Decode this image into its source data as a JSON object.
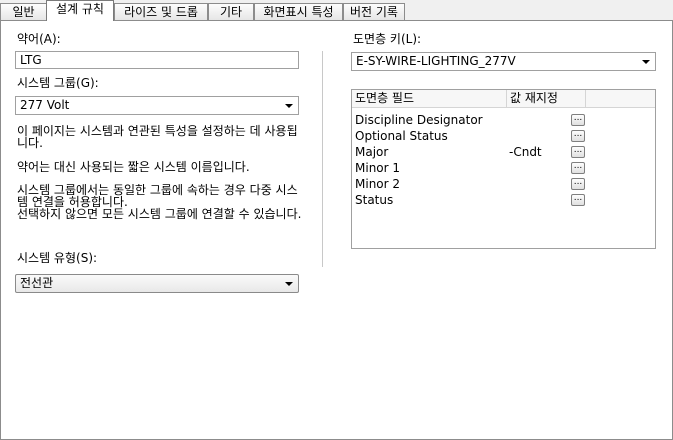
{
  "tabs": [
    {
      "label": "일반",
      "active": false
    },
    {
      "label": "설계 규칙",
      "active": true
    },
    {
      "label": "라이즈 및 드롭",
      "active": false
    },
    {
      "label": "기타",
      "active": false
    },
    {
      "label": "화면표시 특성",
      "active": false
    },
    {
      "label": "버전 기록",
      "active": false
    }
  ],
  "left": {
    "abbr_label": "약어(A):",
    "abbr_value": "LTG",
    "group_label": "시스템 그룹(G):",
    "group_value": "277 Volt",
    "desc1": "이 페이지는 시스템과 연관된 특성을 설정하는 데 사용됩니다.",
    "desc2": "약어는 대신 사용되는 짧은 시스템 이름입니다.",
    "desc3": "시스템 그룹에서는 동일한 그룹에 속하는 경우 다중 시스템 연결을 허용합니다.",
    "desc4": "선택하지 않으면 모든 시스템 그룹에 연결할 수 있습니다.",
    "type_label": "시스템 유형(S):",
    "type_value": "전선관"
  },
  "right": {
    "layer_key_label": "도면층 키(L):",
    "layer_key_value": "E-SY-WIRE-LIGHTING_277V",
    "grid_headers": {
      "field": "도면층 필드",
      "override": "값 재지정"
    },
    "grid_rows": [
      {
        "field": "Discipline Designator",
        "value": "",
        "button": "..."
      },
      {
        "field": "Optional Status",
        "value": "",
        "button": "..."
      },
      {
        "field": "Major",
        "value": "-Cndt",
        "button": "..."
      },
      {
        "field": "Minor 1",
        "value": "",
        "button": "..."
      },
      {
        "field": "Minor 2",
        "value": "",
        "button": "..."
      },
      {
        "field": "Status",
        "value": "",
        "button": "..."
      }
    ]
  }
}
